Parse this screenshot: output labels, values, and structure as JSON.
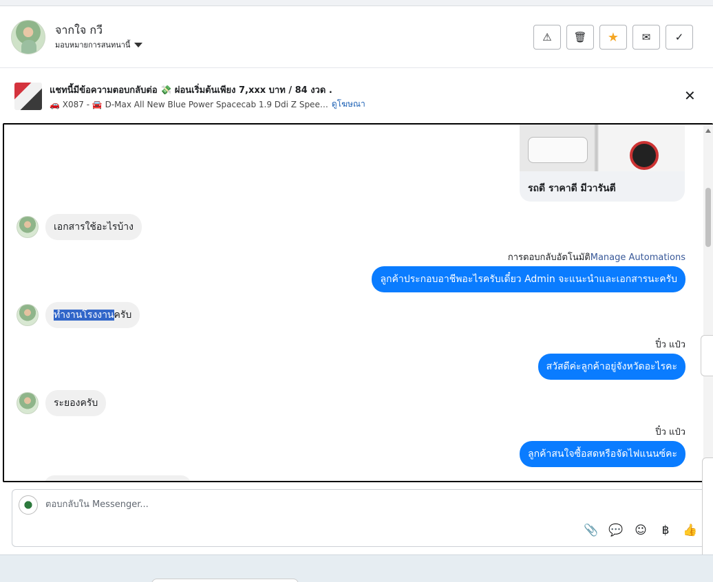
{
  "header": {
    "contact_name": "จากใจ กวี",
    "assign_label": "มอบหมายการสนทนานี้",
    "actions": [
      {
        "icon": "warning-icon",
        "glyph": "⚠"
      },
      {
        "icon": "trash-icon",
        "glyph": "🗑"
      },
      {
        "icon": "star-icon",
        "glyph": "★"
      },
      {
        "icon": "mark-unread-icon",
        "glyph": "✉"
      },
      {
        "icon": "check-icon",
        "glyph": "✓"
      }
    ]
  },
  "ad": {
    "title": "แชทนี้มีข้อความตอบกลับต่อ 💸 ผ่อนเริ่มต้นเพียง 7,xxx บาท / 84 งวด .",
    "subtitle": "🚗 X087 - 🚘 D-Max All New Blue Power Spacecab 1.9 Ddi Z Spee…",
    "link": "ดูโฆษณา",
    "close_glyph": "✕"
  },
  "messages": {
    "card_caption": "รถดี ราคาดี มีวารันตี",
    "in1": "เอกสารใช้อะไรบ้าง",
    "auto_reply_label": "การตอบกลับอัตโนมัติ",
    "manage_automations": "Manage Automations",
    "out1": "ลูกค้าประกอบอาชีพอะไรครับเดี๋ยว Admin จะแนะนำและเอกสารนะครับ",
    "in2_highlight": "ทำงานโรงงาน",
    "in2_rest": "ครับ",
    "sender1": "ปิ๋ว แป๋ว",
    "out2": "สวัสดีค่ะลูกค้าอยู่จังหวัดอะไรคะ",
    "in3": "ระยองครับ",
    "sender2": "ปิ๋ว แป๋ว",
    "out3": "ลูกค้าสนใจซื้อสดหรือจัดไฟแนนซ์คะ"
  },
  "composer": {
    "placeholder": "ตอบกลับใน Messenger...",
    "tools": [
      {
        "icon": "attach-icon",
        "glyph": "📎"
      },
      {
        "icon": "saved-reply-icon",
        "glyph": "💬"
      },
      {
        "icon": "emoji-icon",
        "glyph": "☺"
      },
      {
        "icon": "baht-icon",
        "glyph": "฿"
      },
      {
        "icon": "thumbs-up-icon",
        "glyph": "👍"
      }
    ]
  },
  "colors": {
    "outgoing_bubble": "#0a7cff",
    "incoming_bubble": "#f0f0f0",
    "star": "#f5a623"
  }
}
